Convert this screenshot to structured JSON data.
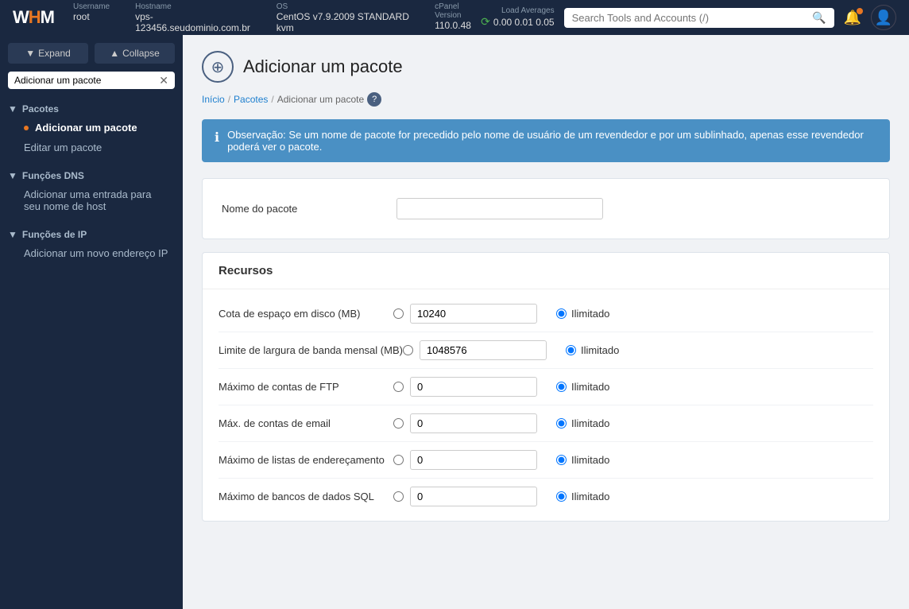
{
  "topbar": {
    "logo": "WHM",
    "server": {
      "username_label": "Username",
      "username": "root",
      "hostname_label": "Hostname",
      "hostname": "vps-123456.seudominio.com.br",
      "os_label": "OS",
      "os": "CentOS v7.9.2009 STANDARD kvm",
      "cpanel_label": "cPanel Version",
      "cpanel": "110.0.48",
      "load_label": "Load Averages",
      "load": "0.00  0.01  0.05"
    },
    "search_placeholder": "Search Tools and Accounts (/)"
  },
  "sidebar": {
    "expand_label": "Expand",
    "collapse_label": "Collapse",
    "search_value": "Adicionar um pacote",
    "sections": [
      {
        "id": "pacotes",
        "label": "Pacotes",
        "items": [
          {
            "label": "Adicionar um pacote",
            "active": true
          },
          {
            "label": "Editar um pacote",
            "active": false
          }
        ]
      },
      {
        "id": "funcoes-dns",
        "label": "Funções DNS",
        "items": [
          {
            "label": "Adicionar uma entrada para seu nome de host",
            "active": false
          }
        ]
      },
      {
        "id": "funcoes-ip",
        "label": "Funções de IP",
        "items": [
          {
            "label": "Adicionar um novo endereço IP",
            "active": false
          }
        ]
      }
    ]
  },
  "page": {
    "title": "Adicionar um pacote",
    "breadcrumb": {
      "home": "Início",
      "section": "Pacotes",
      "current": "Adicionar um pacote"
    },
    "info_banner": "Observação: Se um nome de pacote for precedido pelo nome de usuário de um revendedor e por um sublinhado, apenas esse revendedor poderá ver o pacote.",
    "package_name_label": "Nome do pacote",
    "resources_header": "Recursos",
    "resources": [
      {
        "id": "disk-quota",
        "label": "Cota de espaço em disco (MB)",
        "value": "10240",
        "unlimited_label": "Ilimitado"
      },
      {
        "id": "bandwidth",
        "label": "Limite de largura de banda mensal (MB)",
        "value": "1048576",
        "unlimited_label": "Ilimitado"
      },
      {
        "id": "ftp-accounts",
        "label": "Máximo de contas de FTP",
        "value": "0",
        "unlimited_label": "Ilimitado"
      },
      {
        "id": "email-accounts",
        "label": "Máx. de contas de email",
        "value": "0",
        "unlimited_label": "Ilimitado"
      },
      {
        "id": "mailing-lists",
        "label": "Máximo de listas de endereçamento",
        "value": "0",
        "unlimited_label": "Ilimitado"
      },
      {
        "id": "sql-databases",
        "label": "Máximo de bancos de dados SQL",
        "value": "0",
        "unlimited_label": "Ilimitado"
      }
    ]
  }
}
